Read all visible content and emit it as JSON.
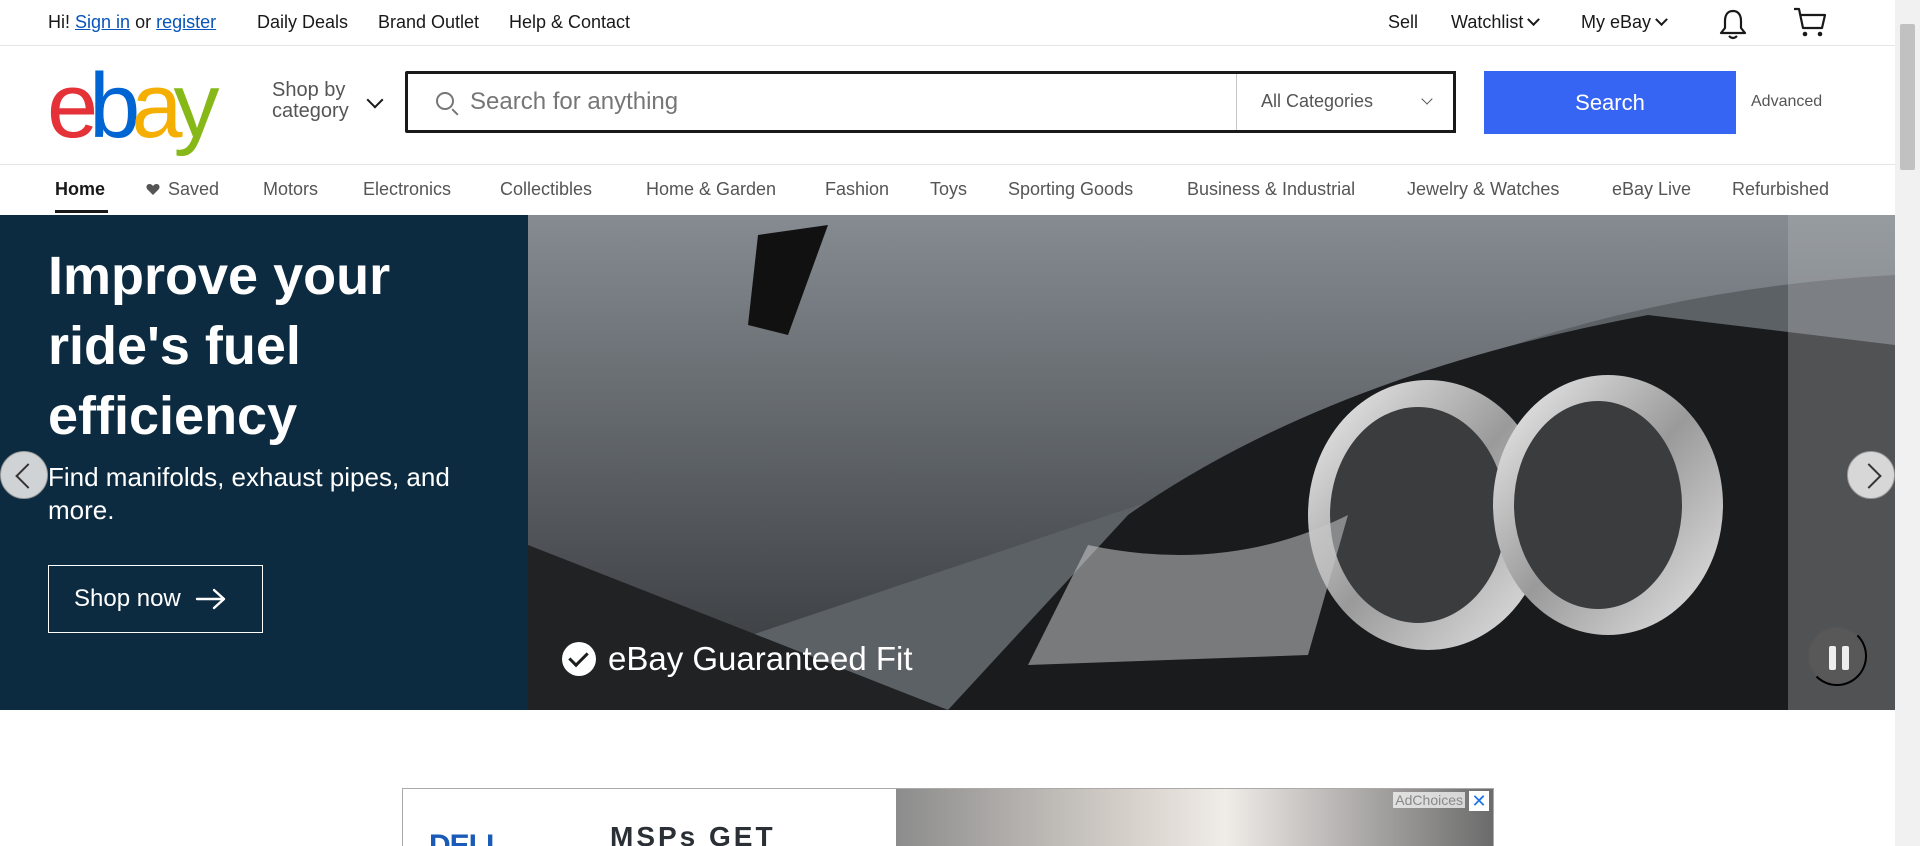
{
  "topbar": {
    "greeting": "Hi!",
    "sign_in": "Sign in",
    "or": "or",
    "register": "register",
    "links": [
      "Daily Deals",
      "Brand Outlet",
      "Help & Contact"
    ],
    "sell": "Sell",
    "watchlist": "Watchlist",
    "my_ebay": "My eBay",
    "icons": [
      "bell-icon",
      "cart-icon"
    ]
  },
  "header": {
    "logo": {
      "letters": [
        "e",
        "b",
        "a",
        "y"
      ],
      "colors": [
        "#e53238",
        "#0064d2",
        "#f5af02",
        "#86b817"
      ]
    },
    "shop_by": "Shop by",
    "category": "category",
    "search_placeholder": "Search for anything",
    "search_value": "",
    "category_select": "All Categories",
    "search_button": "Search",
    "advanced": "Advanced"
  },
  "nav": {
    "items": [
      "Home",
      "Saved",
      "Motors",
      "Electronics",
      "Collectibles",
      "Home & Garden",
      "Fashion",
      "Toys",
      "Sporting Goods",
      "Business & Industrial",
      "Jewelry & Watches",
      "eBay Live",
      "Refurbished"
    ],
    "active": "Home"
  },
  "hero": {
    "title": "Improve your ride's fuel efficiency",
    "subtitle": "Find manifolds, exhaust pipes, and more.",
    "cta": "Shop now",
    "badge": "eBay Guaranteed Fit",
    "bg_color": "#0d2b40"
  },
  "ad": {
    "logo_text": "DELL",
    "headline": "MSPs GET",
    "adchoices": "AdChoices",
    "close": "✕"
  },
  "colors": {
    "accent": "#3665f3",
    "link": "#0654ba"
  }
}
